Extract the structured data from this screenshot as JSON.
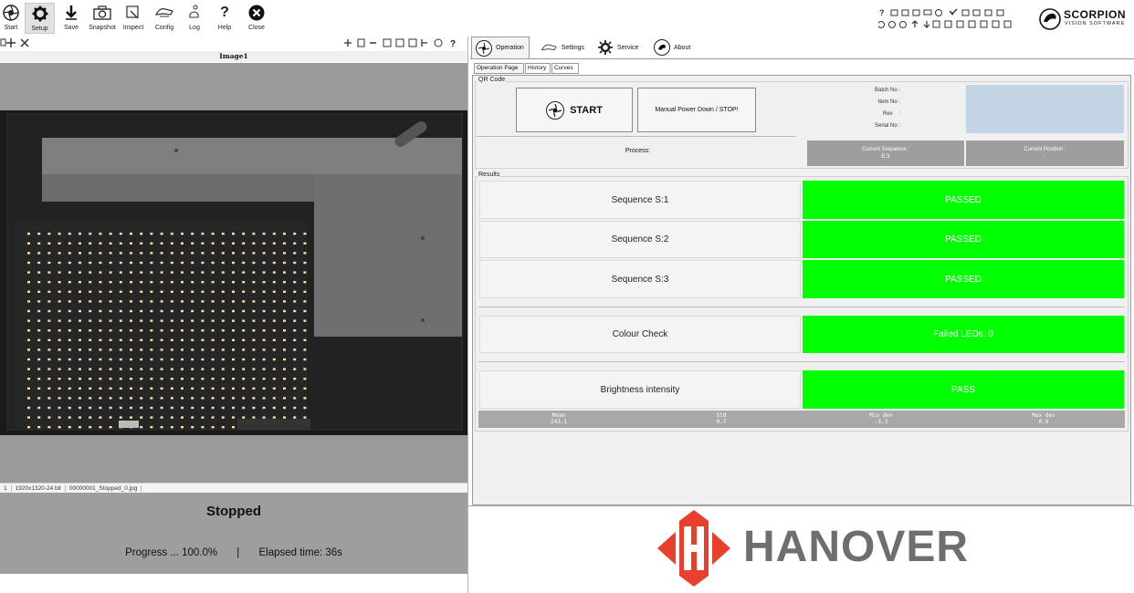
{
  "toolbar": {
    "buttons": [
      {
        "label": "Start",
        "icon": "aperture-icon"
      },
      {
        "label": "Setup",
        "icon": "gear-icon"
      },
      {
        "label": "Save",
        "icon": "save-arrow-icon"
      },
      {
        "label": "Snapshot",
        "icon": "camera-icon"
      },
      {
        "label": "Inspect",
        "icon": "inspect-icon"
      },
      {
        "label": "Config",
        "icon": "config-icon"
      },
      {
        "label": "Log",
        "icon": "log-icon"
      },
      {
        "label": "Help",
        "icon": "question-icon"
      },
      {
        "label": "Close",
        "icon": "close-icon"
      }
    ],
    "help_glyph": "?"
  },
  "left": {
    "image_title": "Image1",
    "statusbar": {
      "index": "1",
      "resolution": "1920x1320-24 bit",
      "filename": "00000001_Stopped_0.jpg"
    },
    "status": "Stopped",
    "progress_label": "Progress ... 100.0%",
    "separator": "|",
    "elapsed": "Elapsed time: 36s"
  },
  "right": {
    "tabs": [
      "Operation",
      "Settings",
      "Service",
      "About"
    ],
    "subtabs": [
      "Operation Page",
      "History",
      "Curves"
    ],
    "qr_group": "QR Code",
    "start_label": "START",
    "stop_label": "Manual Power Down / STOP!",
    "info": {
      "labels": [
        "Batch No :",
        "Item No :",
        "Rev    :",
        "Serial No :"
      ],
      "values": [
        "-",
        "-",
        "-",
        "-"
      ]
    },
    "process_label": "Process:",
    "current_sequence": {
      "label": "Current Sequence :",
      "value": "E:3"
    },
    "current_position": {
      "label": "Current Position :",
      "value": "-"
    },
    "results_group": "Results",
    "results": [
      {
        "label": "Sequence S:1",
        "value": "PASSED"
      },
      {
        "label": "Sequence S:2",
        "value": "PASSED"
      },
      {
        "label": "Sequence S:3",
        "value": "PASSED"
      },
      {
        "label": "Colour Check",
        "value": "Failed LEDs: 0"
      },
      {
        "label": "Brightness intensity",
        "value": "PASS"
      }
    ],
    "stats": [
      {
        "label": "Mean",
        "value": "243.1"
      },
      {
        "label": "Std",
        "value": "0.7"
      },
      {
        "label": "Min dev",
        "value": "-3.3"
      },
      {
        "label": "Max dev",
        "value": "0.9"
      }
    ],
    "brand": "HANOVER",
    "scorpion": {
      "name": "SCORPION",
      "tagline": "VISION SOFTWARE"
    }
  },
  "colors": {
    "pass": "#00ff00",
    "hanover_red": "#e8402d",
    "hanover_grey": "#6d6e71"
  }
}
